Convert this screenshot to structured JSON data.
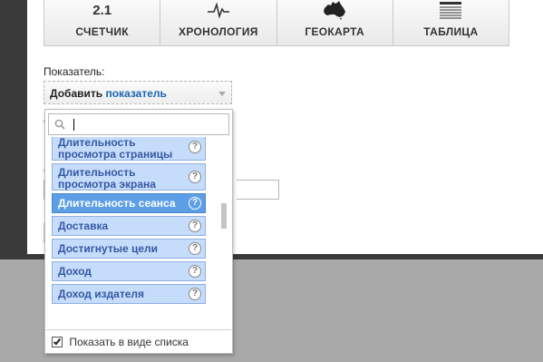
{
  "tabs": [
    {
      "number": "2.1",
      "label": "СЧЕТЧИК",
      "icon": "counter-icon"
    },
    {
      "label": "ХРОНОЛОГИЯ",
      "icon": "timeline-icon"
    },
    {
      "label": "ГЕОКАРТА",
      "icon": "australia-map-icon"
    },
    {
      "label": "ТАБЛИЦА",
      "icon": "table-icon"
    }
  ],
  "metric": {
    "label": "Показатель:",
    "select_add": "Добавить",
    "select_metric": "показатель"
  },
  "background": {
    "char1": "С",
    "char2": "С"
  },
  "dropdown": {
    "search_placeholder": "",
    "items": [
      {
        "label": "Длительность просмотра страницы",
        "selected": false
      },
      {
        "label": "Длительность просмотра экрана",
        "selected": false
      },
      {
        "label": "Длительность сеанса",
        "selected": true
      },
      {
        "label": "Доставка",
        "selected": false
      },
      {
        "label": "Достигнутые цели",
        "selected": false
      },
      {
        "label": "Доход",
        "selected": false
      },
      {
        "label": "Доход издателя",
        "selected": false
      }
    ],
    "help_glyph": "?",
    "footer_label": "Показать в виде списка",
    "footer_checked": true
  },
  "colors": {
    "item_bg": "#c6dcfb",
    "item_text": "#3558a4",
    "selected_bg": "#5c9fe6",
    "link_blue": "#1a66b3"
  }
}
